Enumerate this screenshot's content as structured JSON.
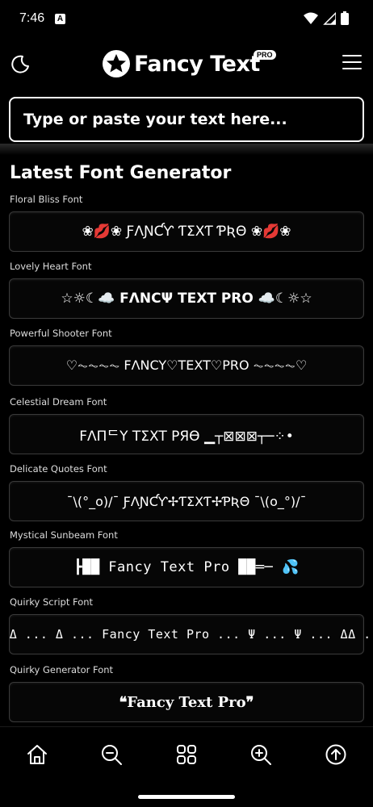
{
  "status": {
    "time": "7:46",
    "notification_icon": "A"
  },
  "header": {
    "logo_text": "Fancy Text",
    "pro_badge": "PRO"
  },
  "input": {
    "placeholder": "Type or paste your text here..."
  },
  "section_title": "Latest Font Generator",
  "fonts": [
    {
      "label": "Floral Bliss Font",
      "sample": "❀💋❀ ƑΛƝƇƳ ƬΣXƬ ƤƦΘ ❀💋❀"
    },
    {
      "label": "Lovely Heart Font",
      "sample": "☆☼☾☁️ FΛNCΨ TEXT PRO ☁️☾☼☆"
    },
    {
      "label": "Powerful Shooter Font",
      "sample": "♡⏦⏦⏦⏦ FΛNCY♡TEXT♡PRO ⏦⏦⏦⏦♡"
    },
    {
      "label": "Celestial Dream Font",
      "sample": "FΛΠᄃY TΣXT PЯӨ ▁┬⊠⊠⊠┬─⁘•"
    },
    {
      "label": "Delicate Quotes Font",
      "sample": "¯\\(°_o)/¯ ƑΛƝƇƳ✢ƬΣXƬ✢ƤƦΘ ¯\\(o_°)/¯"
    },
    {
      "label": "Mystical Sunbeam Font",
      "sample": "┣██ Fancy Text Pro ██═─ 💦"
    },
    {
      "label": "Quirky Script Font",
      "sample": "Ψ ... Δ ... Δ ... Fancy Text Pro ... Ψ ... Ψ ... ΔΔ ... ☀️"
    },
    {
      "label": "Quirky Generator Font",
      "sample": "❝Fancy Text Pro❞"
    }
  ],
  "icons": {
    "moon": "moon-icon",
    "menu": "menu-icon",
    "home": "home-icon",
    "zoom_out": "zoom-out-icon",
    "grid": "grid-icon",
    "zoom_in": "zoom-in-icon",
    "scroll_top": "arrow-up-circle-icon"
  }
}
